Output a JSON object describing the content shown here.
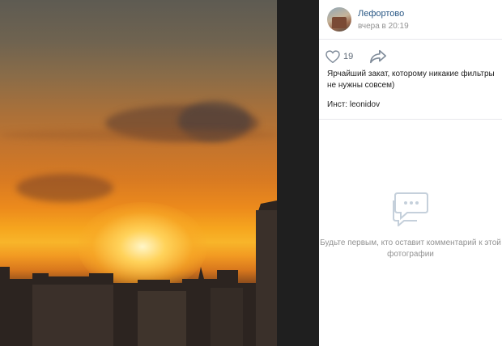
{
  "post": {
    "group_name": "Лефортово",
    "time": "вчера в 20:19",
    "likes": "19",
    "caption": "Ярчайший закат, которому никакие фильтры не нужны совсем)",
    "credit": "Инст: leonidov"
  },
  "comments": {
    "empty_text": "Будьте первым, кто оставит комментарий к этой фотографии"
  },
  "icons": {
    "like": "heart-icon",
    "share": "share-arrow-icon",
    "comments": "speech-bubble-icon"
  },
  "colors": {
    "link": "#2a5885",
    "muted": "#939393",
    "border": "#e7e8ec"
  }
}
